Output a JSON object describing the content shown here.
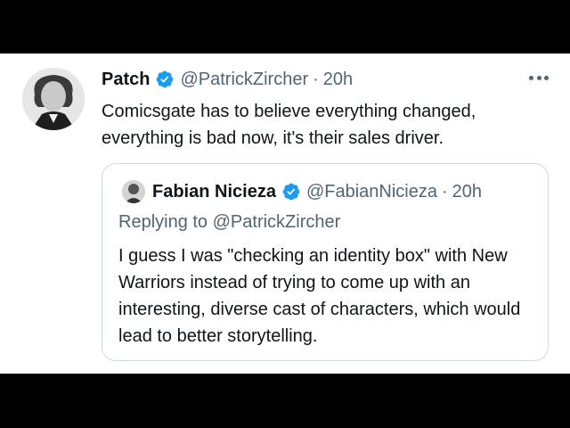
{
  "tweet": {
    "author_name": "Patch",
    "author_handle": "@PatrickZircher",
    "separator": "·",
    "time": "20h",
    "text": "Comicsgate has to believe everything changed, everything is bad now, it's their sales driver."
  },
  "quoted": {
    "author_name": "Fabian Nicieza",
    "author_handle": "@FabianNicieza",
    "separator": "·",
    "time": "20h",
    "replying_prefix": "Replying to",
    "replying_handle": "@PatrickZircher",
    "text": "I guess I was \"checking an identity box\" with New Warriors instead of trying to come up with an interesting, diverse cast of characters, which would lead to better storytelling."
  },
  "icons": {
    "verified": "verified-badge-icon",
    "more": "more-options-icon"
  },
  "colors": {
    "verified_blue": "#1d9bf0",
    "secondary_text": "#536471",
    "primary_text": "#0f1419",
    "border": "#cfd9de"
  }
}
